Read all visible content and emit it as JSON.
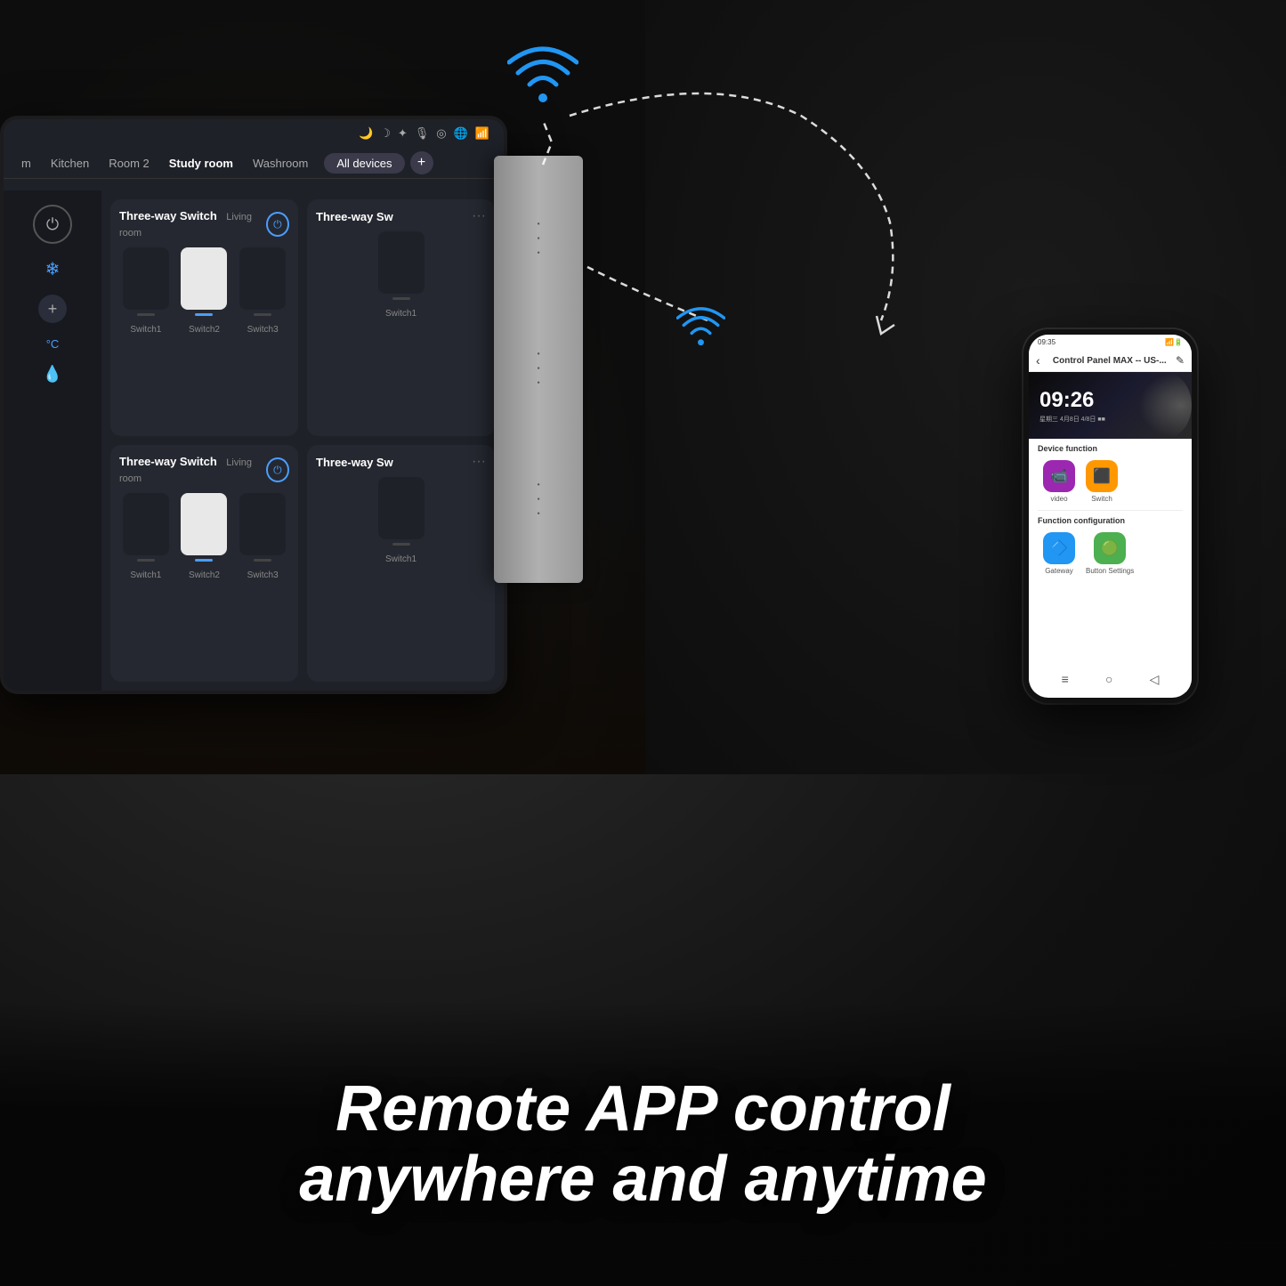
{
  "background": {
    "color": "#1a1a1a"
  },
  "wifi_top": {
    "symbol": "📶",
    "unicode": "◟"
  },
  "tablet": {
    "topbar_icons": [
      "🌙",
      "☾",
      "✦",
      "🎙",
      "◎",
      "🌐",
      "📶"
    ],
    "nav_items": [
      {
        "label": "m",
        "active": false
      },
      {
        "label": "Kitchen",
        "active": false
      },
      {
        "label": "Room 2",
        "active": false
      },
      {
        "label": "Study room",
        "active": true
      },
      {
        "label": "Washroom",
        "active": false
      }
    ],
    "all_devices_label": "All devices",
    "plus_label": "+",
    "left_panel": {
      "temp": "°C",
      "snowflake": "❄"
    },
    "cards": [
      {
        "title": "Three-way Switch",
        "room": "Living room",
        "power_on": true,
        "switches": [
          {
            "label": "Switch1",
            "active": false
          },
          {
            "label": "Switch2",
            "active": true
          },
          {
            "label": "Switch3",
            "active": false
          }
        ]
      },
      {
        "title": "Three-way Sw",
        "room": "",
        "power_on": false,
        "switches": [
          {
            "label": "Switch1",
            "active": false
          }
        ],
        "partial": true
      },
      {
        "title": "Three-way Switch",
        "room": "Living room",
        "power_on": true,
        "switches": [
          {
            "label": "Switch1",
            "active": false
          },
          {
            "label": "Switch2",
            "active": true
          },
          {
            "label": "Switch3",
            "active": false
          }
        ]
      },
      {
        "title": "Three-way Sw",
        "room": "",
        "power_on": false,
        "switches": [
          {
            "label": "Switch1",
            "active": false
          }
        ],
        "partial": true
      }
    ]
  },
  "smartphone": {
    "status_time": "09:35",
    "title": "Control Panel MAX -- US-...",
    "clock_time": "09:26",
    "clock_date": "星期三 4月8日 4/8日 ■■",
    "device_function_title": "Device function",
    "function_config_title": "Function configuration",
    "icons": [
      {
        "label": "video",
        "color": "#9c27b0",
        "icon": "📹"
      },
      {
        "label": "Switch",
        "color": "#ff9800",
        "icon": "🔲"
      }
    ],
    "config_icons": [
      {
        "label": "Gateway",
        "color": "#2196F3",
        "icon": "🔲"
      },
      {
        "label": "Button Settings",
        "color": "#4caf50",
        "icon": "🔘"
      }
    ],
    "bottom_icons": [
      "≡",
      "○",
      "◁"
    ]
  },
  "bottom_text": {
    "line1": "Remote APP control",
    "line2": "anywhere and anytime"
  }
}
